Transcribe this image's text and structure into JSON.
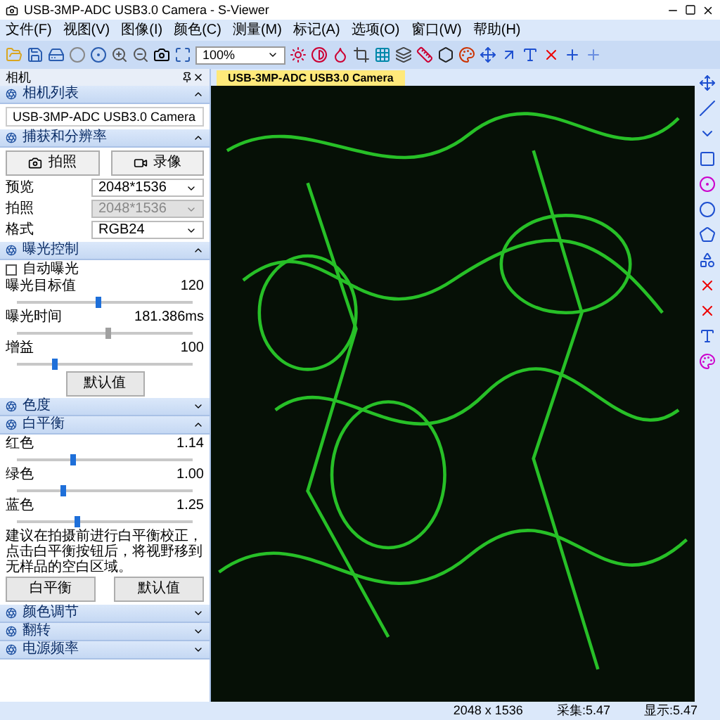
{
  "window": {
    "title": "USB-3MP-ADC USB3.0 Camera - S-Viewer"
  },
  "menu": [
    "文件(F)",
    "视图(V)",
    "图像(I)",
    "颜色(C)",
    "测量(M)",
    "标记(A)",
    "选项(O)",
    "窗口(W)",
    "帮助(H)"
  ],
  "toolbar": {
    "zoom": "100%"
  },
  "panel": {
    "title": "相机",
    "sections": [
      {
        "kind": "camera_list",
        "title": "相机列表",
        "expanded": true,
        "camera": "USB-3MP-ADC USB3.0 Camera"
      },
      {
        "kind": "capture",
        "title": "捕获和分辨率",
        "expanded": true,
        "buttons": [
          "拍照",
          "录像"
        ],
        "fields": [
          {
            "label": "预览",
            "value": "2048*1536",
            "disabled": false
          },
          {
            "label": "拍照",
            "value": "2048*1536",
            "disabled": true
          },
          {
            "label": "格式",
            "value": "RGB24",
            "disabled": false
          }
        ]
      },
      {
        "kind": "exposure",
        "title": "曝光控制",
        "expanded": true,
        "auto": {
          "label": "自动曝光",
          "checked": false
        },
        "sliders": [
          {
            "label": "曝光目标值",
            "reading": "120",
            "level": 0.45,
            "disabled": false
          },
          {
            "label": "曝光时间",
            "reading": "181.386ms",
            "level": 0.5,
            "disabled": true
          },
          {
            "label": "增益",
            "reading": "100",
            "level": 0.2,
            "disabled": false
          }
        ],
        "button": "默认值"
      },
      {
        "title": "色度",
        "expanded": false
      },
      {
        "kind": "white_balance",
        "title": "白平衡",
        "expanded": true,
        "sliders": [
          {
            "label": "红色",
            "reading": "1.14",
            "level": 0.3,
            "disabled": false
          },
          {
            "label": "绿色",
            "reading": "1.00",
            "level": 0.25,
            "disabled": false
          },
          {
            "label": "蓝色",
            "reading": "1.25",
            "level": 0.33,
            "disabled": false
          }
        ],
        "note": "建议在拍摄前进行白平衡校正，点击白平衡按钮后，将视野移到无样品的空白区域。",
        "buttons": [
          "白平衡",
          "默认值"
        ]
      },
      {
        "title": "颜色调节",
        "expanded": false
      },
      {
        "title": "翻转",
        "expanded": false
      },
      {
        "title": "电源频率",
        "expanded": false
      }
    ]
  },
  "image_tab": {
    "label": "USB-3MP-ADC USB3.0 Camera",
    "selected": true
  },
  "status_bar": [
    "2048 x 1536",
    "采集:5.47",
    "显示:5.47"
  ]
}
